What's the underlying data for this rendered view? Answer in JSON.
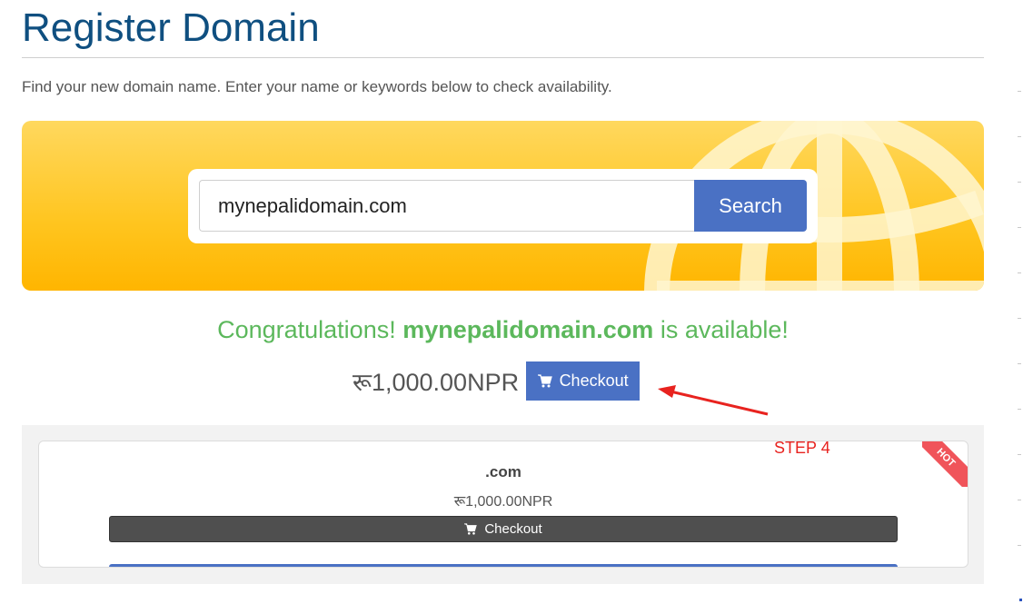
{
  "page": {
    "title": "Register Domain",
    "intro": "Find your new domain name. Enter your name or keywords below to check availability."
  },
  "search": {
    "value": "mynepalidomain.com",
    "button_label": "Search"
  },
  "result": {
    "prefix": "Congratulations!",
    "domain": "mynepalidomain.com",
    "suffix": "is available!",
    "price": "रू1,000.00NPR",
    "checkout_label": "Checkout"
  },
  "annotation": {
    "step_label": "STEP 4"
  },
  "suggestion": {
    "tld": ".com",
    "price": "रू1,000.00NPR",
    "checkout_label": "Checkout",
    "ribbon": "HOT"
  },
  "colors": {
    "title": "#0f4f80",
    "primary": "#4a71c4",
    "success": "#5cb85c",
    "banner": "#ffc51f",
    "annotation": "#e8231f",
    "ribbon": "#f0545a"
  },
  "icons": [
    "cart-icon",
    "globe-graphic",
    "arrow-annotation"
  ]
}
